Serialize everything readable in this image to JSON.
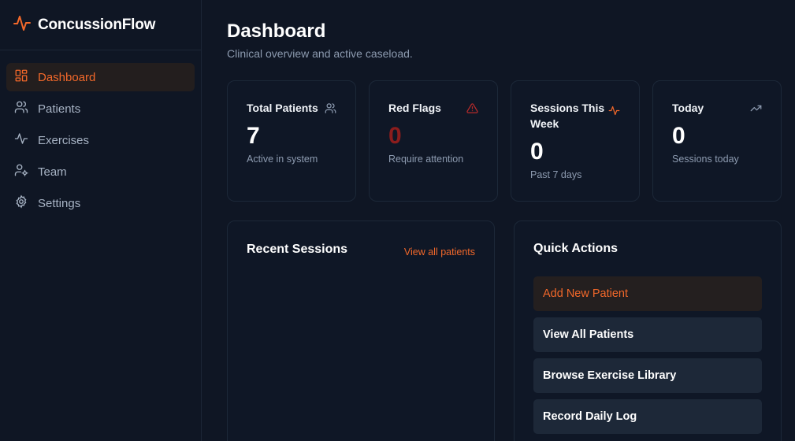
{
  "brand": {
    "name": "ConcussionFlow",
    "icon": "activity-icon",
    "accent": "#f2682a"
  },
  "sidebar": {
    "items": [
      {
        "label": "Dashboard",
        "icon": "layout-dashboard-icon",
        "active": true
      },
      {
        "label": "Patients",
        "icon": "users-icon",
        "active": false
      },
      {
        "label": "Exercises",
        "icon": "activity-icon",
        "active": false
      },
      {
        "label": "Team",
        "icon": "user-cog-icon",
        "active": false
      },
      {
        "label": "Settings",
        "icon": "gear-icon",
        "active": false
      }
    ]
  },
  "header": {
    "title": "Dashboard",
    "subtitle": "Clinical overview and active caseload."
  },
  "stats": [
    {
      "label": "Total Patients",
      "value": "7",
      "sub": "Active in system",
      "icon": "users-icon"
    },
    {
      "label": "Red Flags",
      "value": "0",
      "sub": "Require attention",
      "icon": "alert-triangle-icon",
      "value_color": "#8c1d1d"
    },
    {
      "label": "Sessions This Week",
      "value": "0",
      "sub": "Past 7 days",
      "icon": "activity-icon"
    },
    {
      "label": "Today",
      "value": "0",
      "sub": "Sessions today",
      "icon": "trending-up-icon"
    }
  ],
  "recent_sessions": {
    "title": "Recent Sessions",
    "link": "View all patients"
  },
  "quick_actions": {
    "title": "Quick Actions",
    "buttons": [
      {
        "label": "Add New Patient"
      },
      {
        "label": "View All Patients"
      },
      {
        "label": "Browse Exercise Library"
      },
      {
        "label": "Record Daily Log"
      }
    ]
  }
}
